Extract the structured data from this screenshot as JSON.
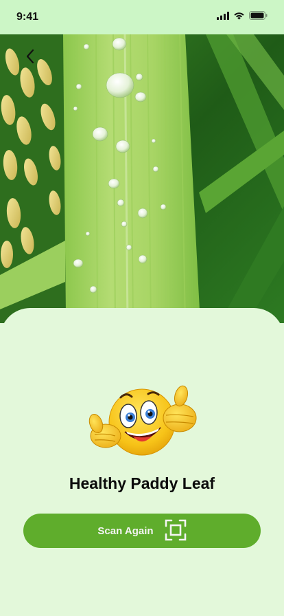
{
  "status": {
    "time": "9:41"
  },
  "icons": {
    "back": "chevron-left-icon",
    "signal": "cellular-signal-icon",
    "wifi": "wifi-icon",
    "battery": "battery-icon",
    "scan": "scan-frame-icon",
    "emoji": "thumbs-up-emoji"
  },
  "hero": {
    "image": "paddy-leaf-photo"
  },
  "result": {
    "title": "Healthy Paddy Leaf"
  },
  "actions": {
    "scan_again_label": "Scan Again"
  },
  "colors": {
    "status_bar": "#ccf6c6",
    "sheet_background": "#e3f8da",
    "button": "#5fad2c",
    "button_text": "#f4f4f4"
  }
}
